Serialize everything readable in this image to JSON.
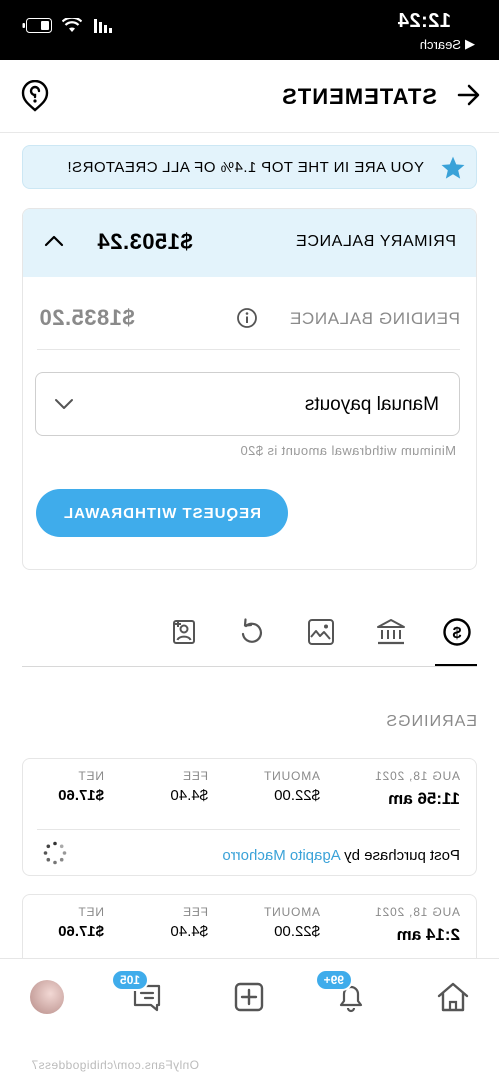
{
  "status_bar": {
    "time": "12:24",
    "back_app": "Search"
  },
  "header": {
    "title": "STATEMENTS"
  },
  "banner": {
    "text": "YOU ARE IN THE TOP 1.4% OF ALL CREATORS!"
  },
  "balance_card": {
    "primary_label": "PRIMARY BALANCE",
    "primary_amount": "$1503.24",
    "pending_label": "PENDING BALANCE",
    "pending_amount": "$1835.20",
    "payout_select": "Manual payouts",
    "min_hint": "Minimum withdrawal amount is $20",
    "withdraw_button": "REQUEST WITHDRAWAL"
  },
  "tabs": [
    "earnings",
    "bank",
    "image",
    "refresh",
    "portrait"
  ],
  "section_title": "EARNINGS",
  "earnings": [
    {
      "date": "AUG 18, 2021",
      "time": "11:56 am",
      "amount_label": "AMOUNT",
      "amount": "$22.00",
      "fee_label": "FEE",
      "fee": "$4.40",
      "net_label": "NET",
      "net": "$17.60",
      "desc_prefix": "Post purchase by",
      "desc_user": "Agapito Machorro"
    },
    {
      "date": "AUG 18, 2021",
      "time": "2:14 am",
      "amount_label": "AMOUNT",
      "amount": "$22.00",
      "fee_label": "FEE",
      "fee": "$4.40",
      "net_label": "NET",
      "net": "$17.60"
    }
  ],
  "bottom_nav": {
    "notifications_badge": "99+",
    "messages_badge": "105"
  },
  "watermark": "OnlyFans.com/chibigoddess7"
}
